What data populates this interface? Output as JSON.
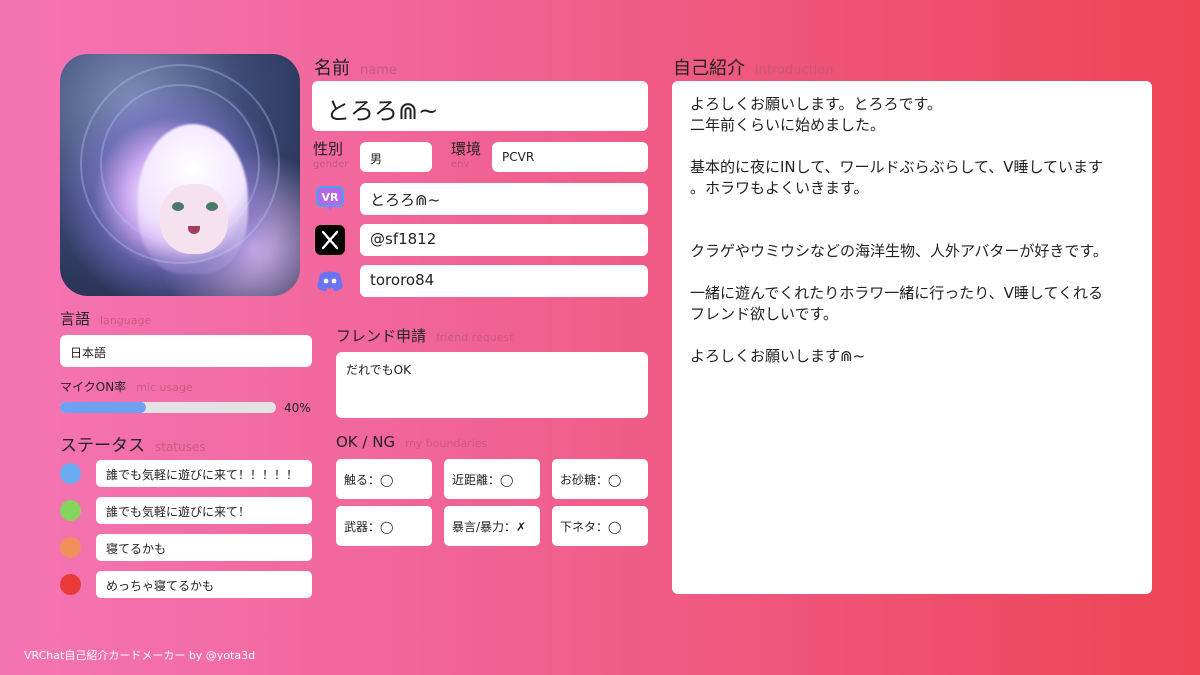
{
  "name": {
    "label": "名前",
    "label_en": "name",
    "value": "とろろ⋒~"
  },
  "gender": {
    "label": "性別",
    "label_en": "gender",
    "value": "男"
  },
  "env": {
    "label": "環境",
    "label_en": "env",
    "value": "PCVR"
  },
  "accounts": {
    "vrchat": {
      "icon": "vrchat-icon",
      "value": "とろろ⋒~"
    },
    "x": {
      "icon": "x-icon",
      "value": "@sf1812"
    },
    "discord": {
      "icon": "discord-icon",
      "value": "tororo84"
    }
  },
  "language": {
    "label": "言語",
    "label_en": "language",
    "value": "日本語"
  },
  "mic": {
    "label": "マイクON率",
    "label_en": "mic usage",
    "percent": 40,
    "percent_text": "40%"
  },
  "statuses": {
    "label": "ステータス",
    "label_en": "statuses",
    "items": [
      {
        "color": "#6aaaf0",
        "text": "誰でも気軽に遊びに来て！！！！！"
      },
      {
        "color": "#84d45e",
        "text": "誰でも気軽に遊びに来て！"
      },
      {
        "color": "#f0905a",
        "text": "寝てるかも"
      },
      {
        "color": "#e83a38",
        "text": "めっちゃ寝てるかも"
      }
    ]
  },
  "friend_request": {
    "label": "フレンド申請",
    "label_en": "friend request",
    "value": "だれでもOK"
  },
  "boundaries": {
    "label": "OK / NG",
    "label_en": "my boundaries",
    "items": [
      "触る：◯",
      "近距離：◯",
      "お砂糖：◯",
      "武器：◯",
      "暴言/暴力：✗",
      "下ネタ：◯"
    ]
  },
  "introduction": {
    "label": "自己紹介",
    "label_en": "introduction",
    "text": "よろしくお願いします。とろろです。\n二年前くらいに始めました。\n\n基本的に夜にINして、ワールドぶらぶらして、V睡しています\n。ホラワもよくいきます。\n\n\nクラゲやウミウシなどの海洋生物、人外アバターが好きです。\n\n一緒に遊んでくれたりホラワ一緒に行ったり、V睡してくれる\nフレンド欲しいです。\n\nよろしくお願いします⋒~"
  },
  "footer": "VRChat自己紹介カードメーカー by @yota3d",
  "colors": {
    "accent_pink": "#f575b4",
    "accent_red": "#ee4455",
    "mic_fill": "#6ea1f2"
  }
}
